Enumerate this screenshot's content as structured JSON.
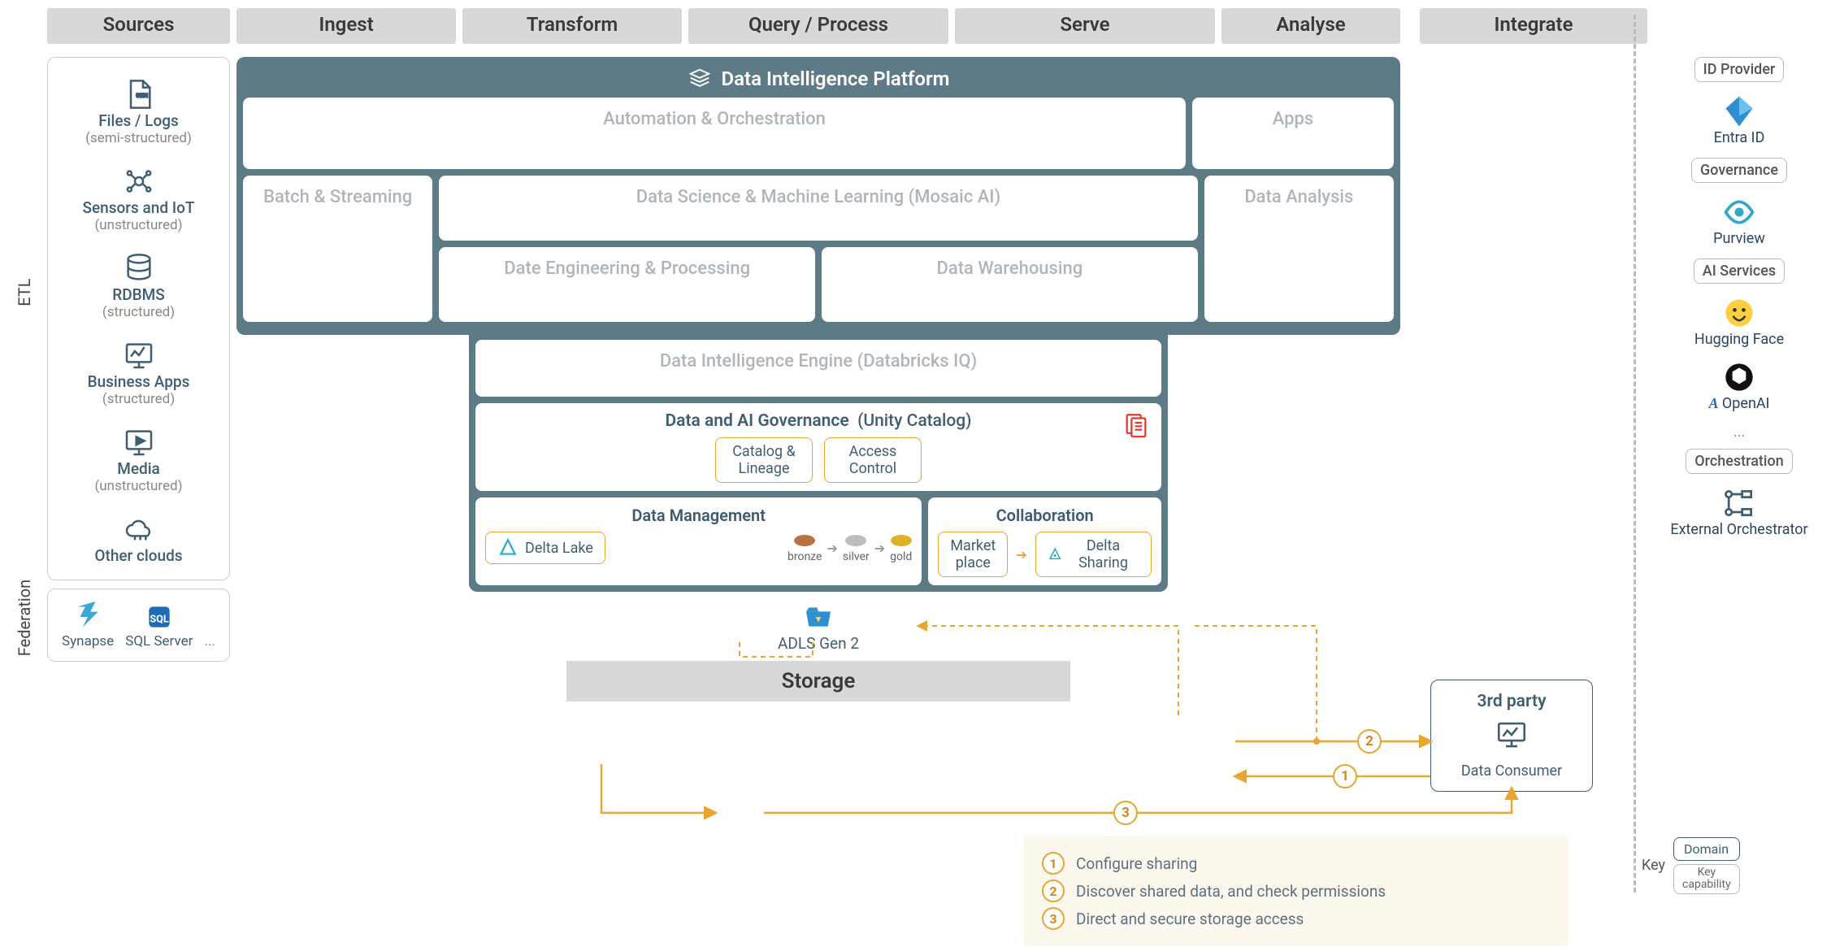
{
  "headers": {
    "sources": "Sources",
    "ingest": "Ingest",
    "transform": "Transform",
    "query": "Query / Process",
    "serve": "Serve",
    "analyse": "Analyse",
    "integrate": "Integrate"
  },
  "side": {
    "etl": "ETL",
    "federation": "Federation"
  },
  "sources": {
    "files": {
      "t1": "Files / Logs",
      "t2": "(semi-structured)"
    },
    "iot": {
      "t1": "Sensors and IoT",
      "t2": "(unstructured)"
    },
    "rdbms": {
      "t1": "RDBMS",
      "t2": "(structured)"
    },
    "bapps": {
      "t1": "Business Apps",
      "t2": "(structured)"
    },
    "media": {
      "t1": "Media",
      "t2": "(unstructured)"
    },
    "clouds": {
      "t1": "Other clouds"
    }
  },
  "federation": {
    "synapse": "Synapse",
    "sqlserver": "SQL Server",
    "more": "..."
  },
  "platform": {
    "title": "Data Intelligence Platform",
    "auto": "Automation & Orchestration",
    "apps": "Apps",
    "batch": "Batch & Streaming",
    "dsml": "Data Science & Machine Learning  (Mosaic AI)",
    "danalysis": "Data Analysis",
    "deng": "Date Engineering & Processing",
    "dw": "Data Warehousing",
    "engine": "Data Intelligence Engine  (Databricks IQ)",
    "gov_title": "Data and AI Governance",
    "gov_sub": "(Unity Catalog)",
    "catalog": "Catalog & Lineage",
    "access": "Access Control",
    "mgmt": "Data Management",
    "delta": "Delta Lake",
    "tiers": {
      "bronze": "bronze",
      "silver": "silver",
      "gold": "gold"
    },
    "collab": "Collaboration",
    "market": "Market place",
    "sharing": "Delta Sharing"
  },
  "storage": {
    "adls": "ADLS Gen 2",
    "label": "Storage"
  },
  "third_party": {
    "title": "3rd party",
    "sub": "Data Consumer"
  },
  "integrate": {
    "id_provider": "ID Provider",
    "entra": "Entra ID",
    "governance": "Governance",
    "purview": "Purview",
    "ai_services": "AI Services",
    "hf": "Hugging Face",
    "openai": "OpenAI",
    "more": "...",
    "orch": "Orchestration",
    "ext_orch": "External Orchestrator"
  },
  "key": {
    "label": "Key",
    "domain": "Domain",
    "cap_l1": "Key",
    "cap_l2": "capability"
  },
  "steps": {
    "s1": "Configure sharing",
    "s2": "Discover shared data, and check permissions",
    "s3": "Direct and secure storage access"
  },
  "nums": {
    "n1": "1",
    "n2": "2",
    "n3": "3"
  },
  "azure_a": "A"
}
